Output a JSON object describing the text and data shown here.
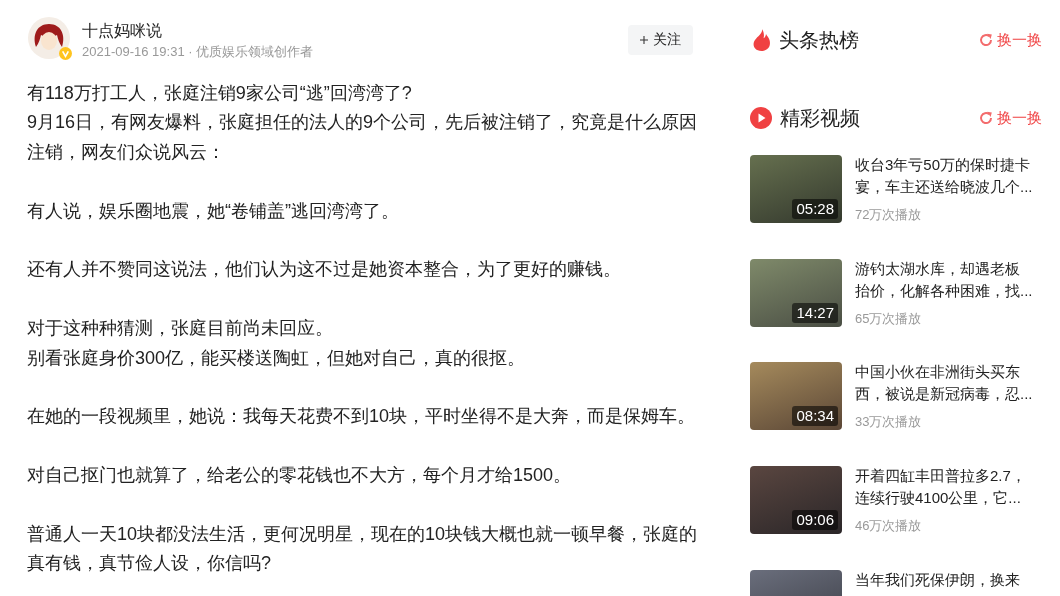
{
  "author": {
    "name": "十点妈咪说",
    "meta": "2021-09-16 19:31 · 优质娱乐领域创作者",
    "verified": true,
    "follow_label": "关注"
  },
  "article": {
    "blocks": [
      [
        "有118万打工人，张庭注销9家公司“逃”回湾湾了?",
        "9月16日，有网友爆料，张庭担任的法人的9个公司，先后被注销了，究竟是什么原因注销，网友们众说风云："
      ],
      [
        "有人说，娱乐圈地震，她“卷铺盖”逃回湾湾了。"
      ],
      [
        "还有人并不赞同这说法，他们认为这不过是她资本整合，为了更好的赚钱。"
      ],
      [
        "对于这种种猜测，张庭目前尚未回应。",
        "别看张庭身价300亿，能买楼送陶虹，但她对自己，真的很抠。"
      ],
      [
        "在她的一段视频里，她说：我每天花费不到10块，平时坐得不是大奔，而是保姆车。"
      ],
      [
        "对自己抠门也就算了，给老公的零花钱也不大方，每个月才给1500。"
      ],
      [
        "普通人一天10块都没法生活，更何况明星，现在的10块钱大概也就一顿早餐，张庭的真有钱，真节俭人设，你信吗?"
      ]
    ]
  },
  "sidebar": {
    "sections": [
      {
        "kind": "hot",
        "title": "头条热榜",
        "refresh_label": "换一换"
      },
      {
        "kind": "video",
        "title": "精彩视频",
        "refresh_label": "换一换",
        "videos": [
          {
            "title": "收台3年亏50万的保时捷卡宴，车主还送给晓波几个...",
            "duration": "05:28",
            "views": "72万次播放"
          },
          {
            "title": "游钓太湖水库，却遇老板抬价，化解各种困难，找...",
            "duration": "14:27",
            "views": "65万次播放"
          },
          {
            "title": "中国小伙在非洲街头买东西，被说是新冠病毒，忍...",
            "duration": "08:34",
            "views": "33万次播放"
          },
          {
            "title": "开着四缸丰田普拉多2.7，连续行驶4100公里，它...",
            "duration": "09:06",
            "views": "46万次播放"
          },
          {
            "title": "当年我们死保伊朗，换来"
          }
        ]
      }
    ]
  }
}
